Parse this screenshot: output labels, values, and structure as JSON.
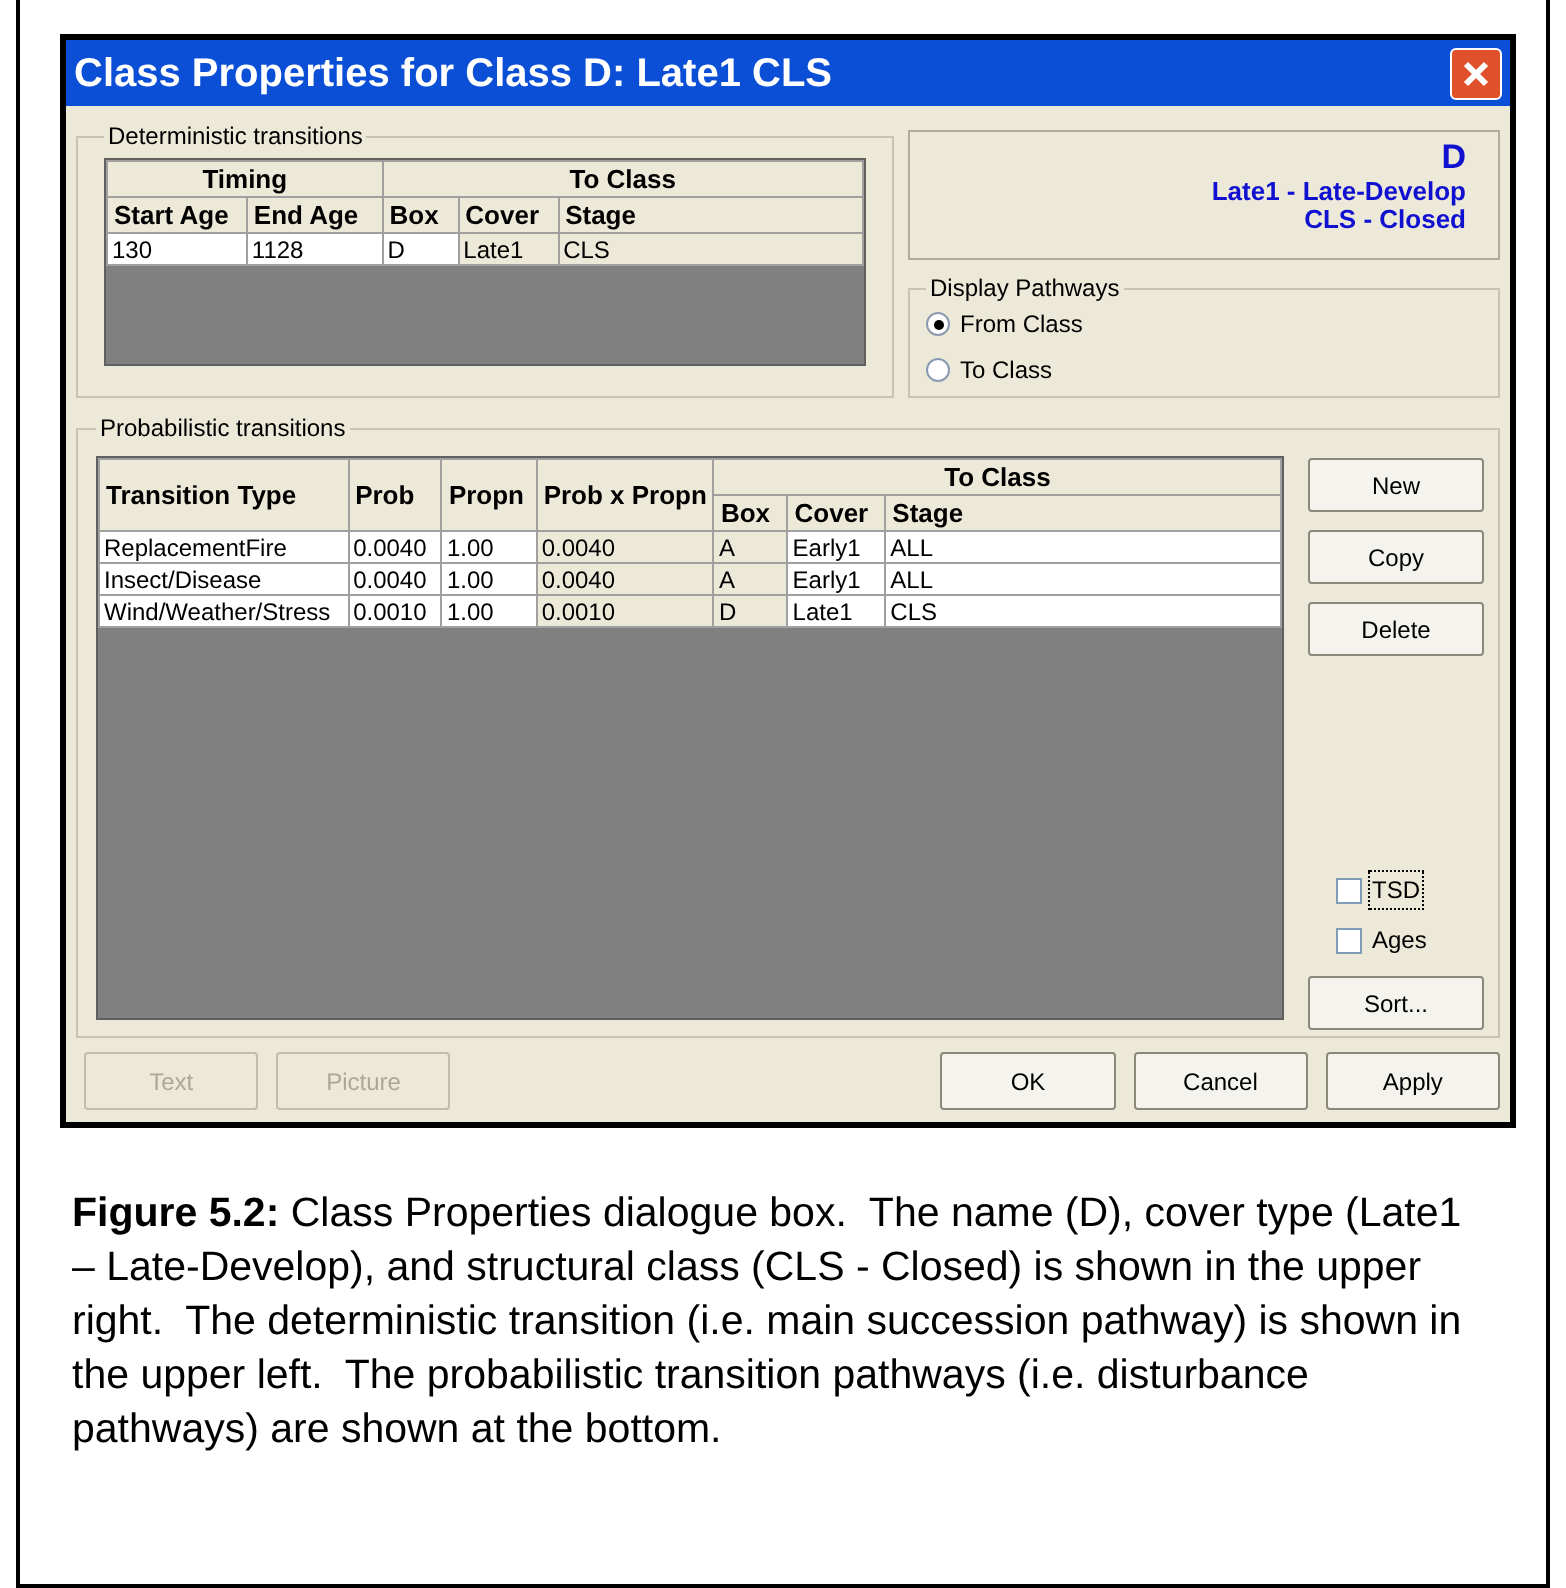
{
  "window": {
    "title": "Class Properties for Class D: Late1 CLS"
  },
  "deterministic": {
    "title": "Deterministic transitions",
    "groups": [
      {
        "label": "Timing"
      },
      {
        "label": "To Class"
      }
    ],
    "columns": [
      {
        "label": "Start Age",
        "editable": true
      },
      {
        "label": "End Age",
        "editable": true
      },
      {
        "label": "Box",
        "editable": true
      },
      {
        "label": "Cover",
        "editable": false
      },
      {
        "label": "Stage",
        "editable": false
      }
    ],
    "rows": [
      [
        "130",
        "1128",
        "D",
        "Late1",
        "CLS"
      ]
    ]
  },
  "class_info": {
    "name": "D",
    "cover": "Late1 - Late-Develop",
    "stage": "CLS - Closed"
  },
  "display_pathways": {
    "title": "Display Pathways",
    "options": [
      {
        "label": "From Class",
        "selected": true
      },
      {
        "label": "To Class",
        "selected": false
      }
    ]
  },
  "probabilistic": {
    "title": "Probabilistic transitions",
    "group": "To Class",
    "columns": [
      {
        "label": "Transition Type",
        "editable": true
      },
      {
        "label": "Prob",
        "editable": true
      },
      {
        "label": "Propn",
        "editable": true
      },
      {
        "label": "Prob x Propn",
        "editable": false
      },
      {
        "label": "Box",
        "editable": false
      },
      {
        "label": "Cover",
        "editable": true
      },
      {
        "label": "Stage",
        "editable": true
      }
    ],
    "rows": [
      [
        "ReplacementFire",
        "0.0040",
        "1.00",
        "0.0040",
        "A",
        "Early1",
        "ALL"
      ],
      [
        "Insect/Disease",
        "0.0040",
        "1.00",
        "0.0040",
        "A",
        "Early1",
        "ALL"
      ],
      [
        "Wind/Weather/Stress",
        "0.0010",
        "1.00",
        "0.0010",
        "D",
        "Late1",
        "CLS"
      ]
    ]
  },
  "side_buttons": [
    "New",
    "Copy",
    "Delete"
  ],
  "checkboxes": [
    {
      "label": "TSD",
      "checked": false,
      "focused": true
    },
    {
      "label": "Ages",
      "checked": false,
      "focused": false
    }
  ],
  "sort_button": "Sort...",
  "bottom_buttons": [
    {
      "label": "Text",
      "disabled": true
    },
    {
      "label": "Picture",
      "disabled": true
    },
    {
      "label": "OK",
      "disabled": false
    },
    {
      "label": "Cancel",
      "disabled": false
    },
    {
      "label": "Apply",
      "disabled": false
    }
  ],
  "caption": "**Figure 5.2:** Class Properties dialogue box.  The name (D), cover type (Late1 – Late-Develop), and structural class (CLS - Closed) is shown in the upper right.  The deterministic transition (i.e. main succession pathway) is shown in the upper left.  The probabilistic transition pathways (i.e. disturbance pathways) are shown at the bottom."
}
